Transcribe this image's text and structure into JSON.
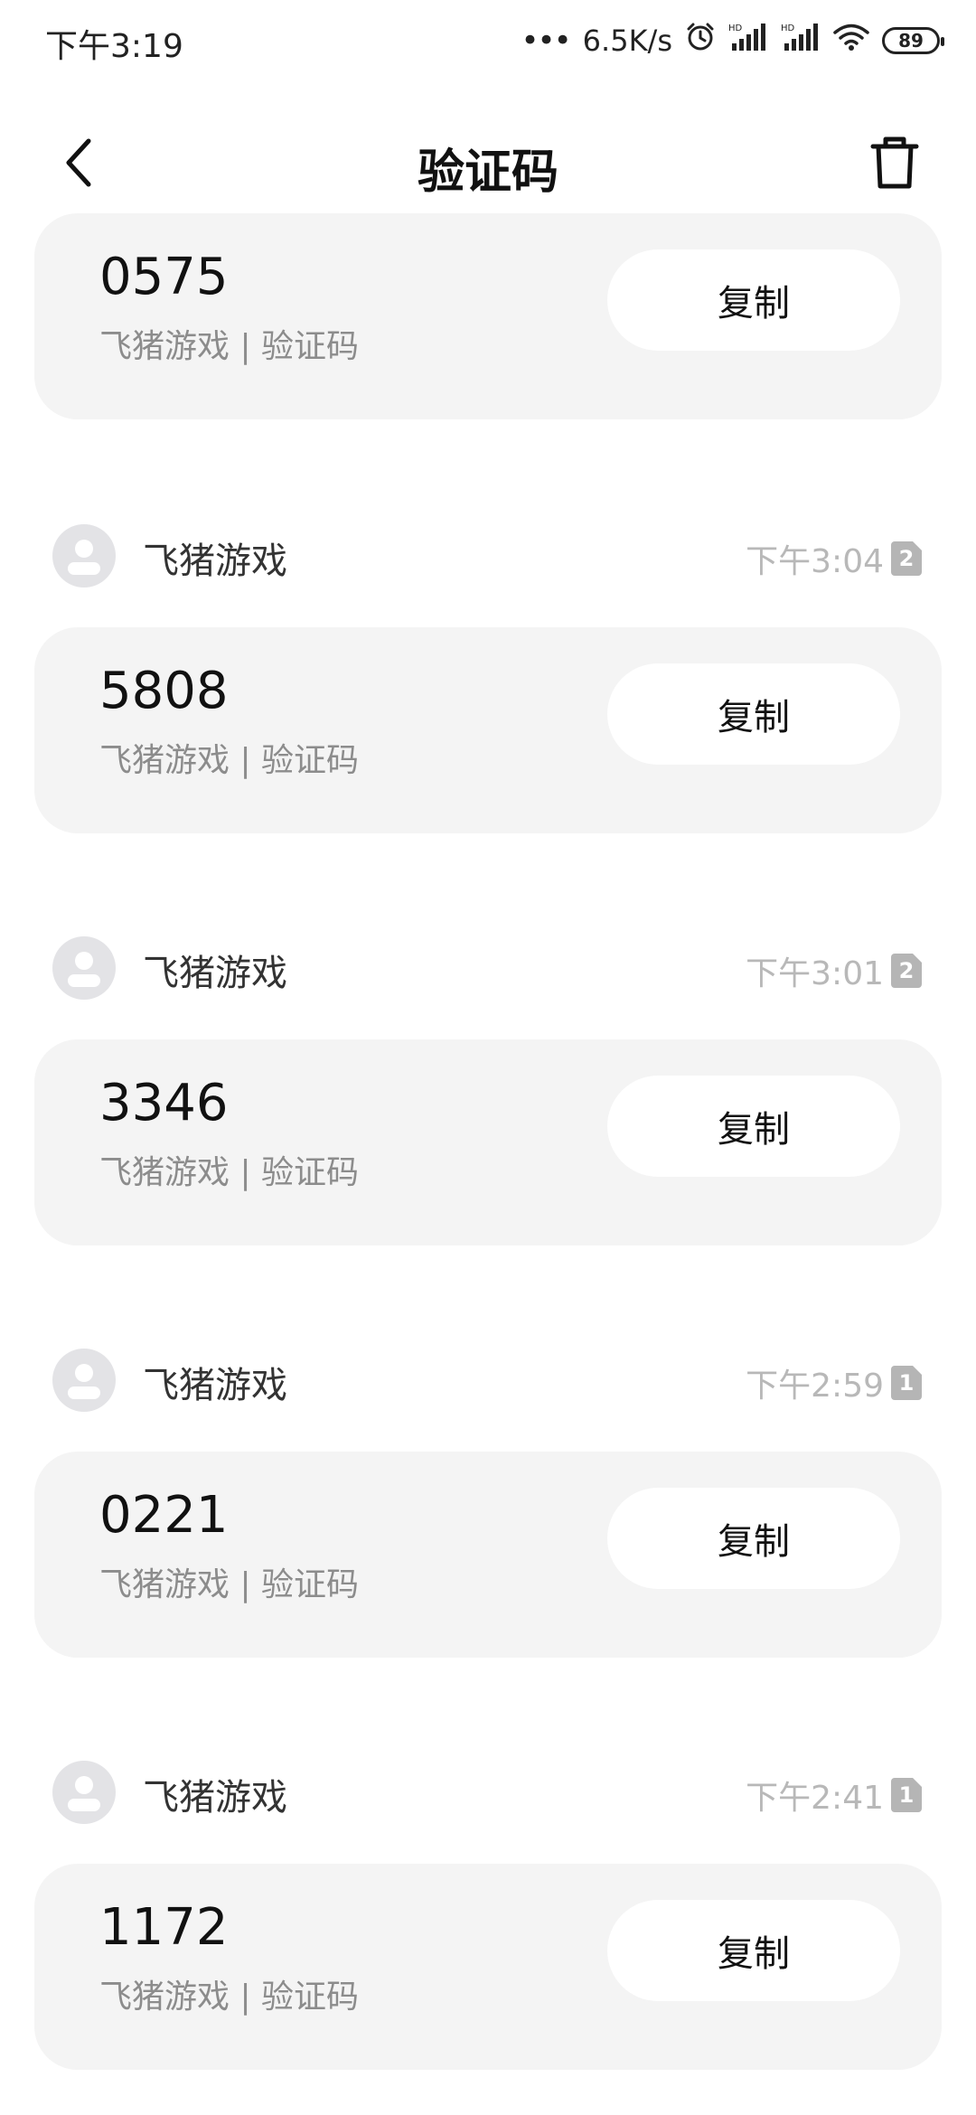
{
  "status_bar": {
    "time": "下午3:19",
    "network_speed": "6.5K/s",
    "battery": "89",
    "icons": [
      "alarm-icon",
      "signal-icon",
      "signal-icon",
      "wifi-icon",
      "battery-icon"
    ]
  },
  "header": {
    "title": "验证码",
    "back_icon": "chevron-left-icon",
    "delete_icon": "trash-icon"
  },
  "copy_label": "复制",
  "messages": [
    {
      "sender": "",
      "time": "",
      "sim": "",
      "code": "0575",
      "sub": "飞猪游戏 | 验证码"
    },
    {
      "sender": "飞猪游戏",
      "time": "下午3:04",
      "sim": "2",
      "code": "5808",
      "sub": "飞猪游戏 | 验证码"
    },
    {
      "sender": "飞猪游戏",
      "time": "下午3:01",
      "sim": "2",
      "code": "3346",
      "sub": "飞猪游戏 | 验证码"
    },
    {
      "sender": "飞猪游戏",
      "time": "下午2:59",
      "sim": "1",
      "code": "0221",
      "sub": "飞猪游戏 | 验证码"
    },
    {
      "sender": "飞猪游戏",
      "time": "下午2:41",
      "sim": "1",
      "code": "1172",
      "sub": "飞猪游戏 | 验证码"
    }
  ],
  "colors": {
    "card_bg": "#f4f4f4",
    "avatar_bg": "#e3e3e6",
    "secondary_text": "#8c8c8c",
    "time_text": "#b8b8b8"
  }
}
